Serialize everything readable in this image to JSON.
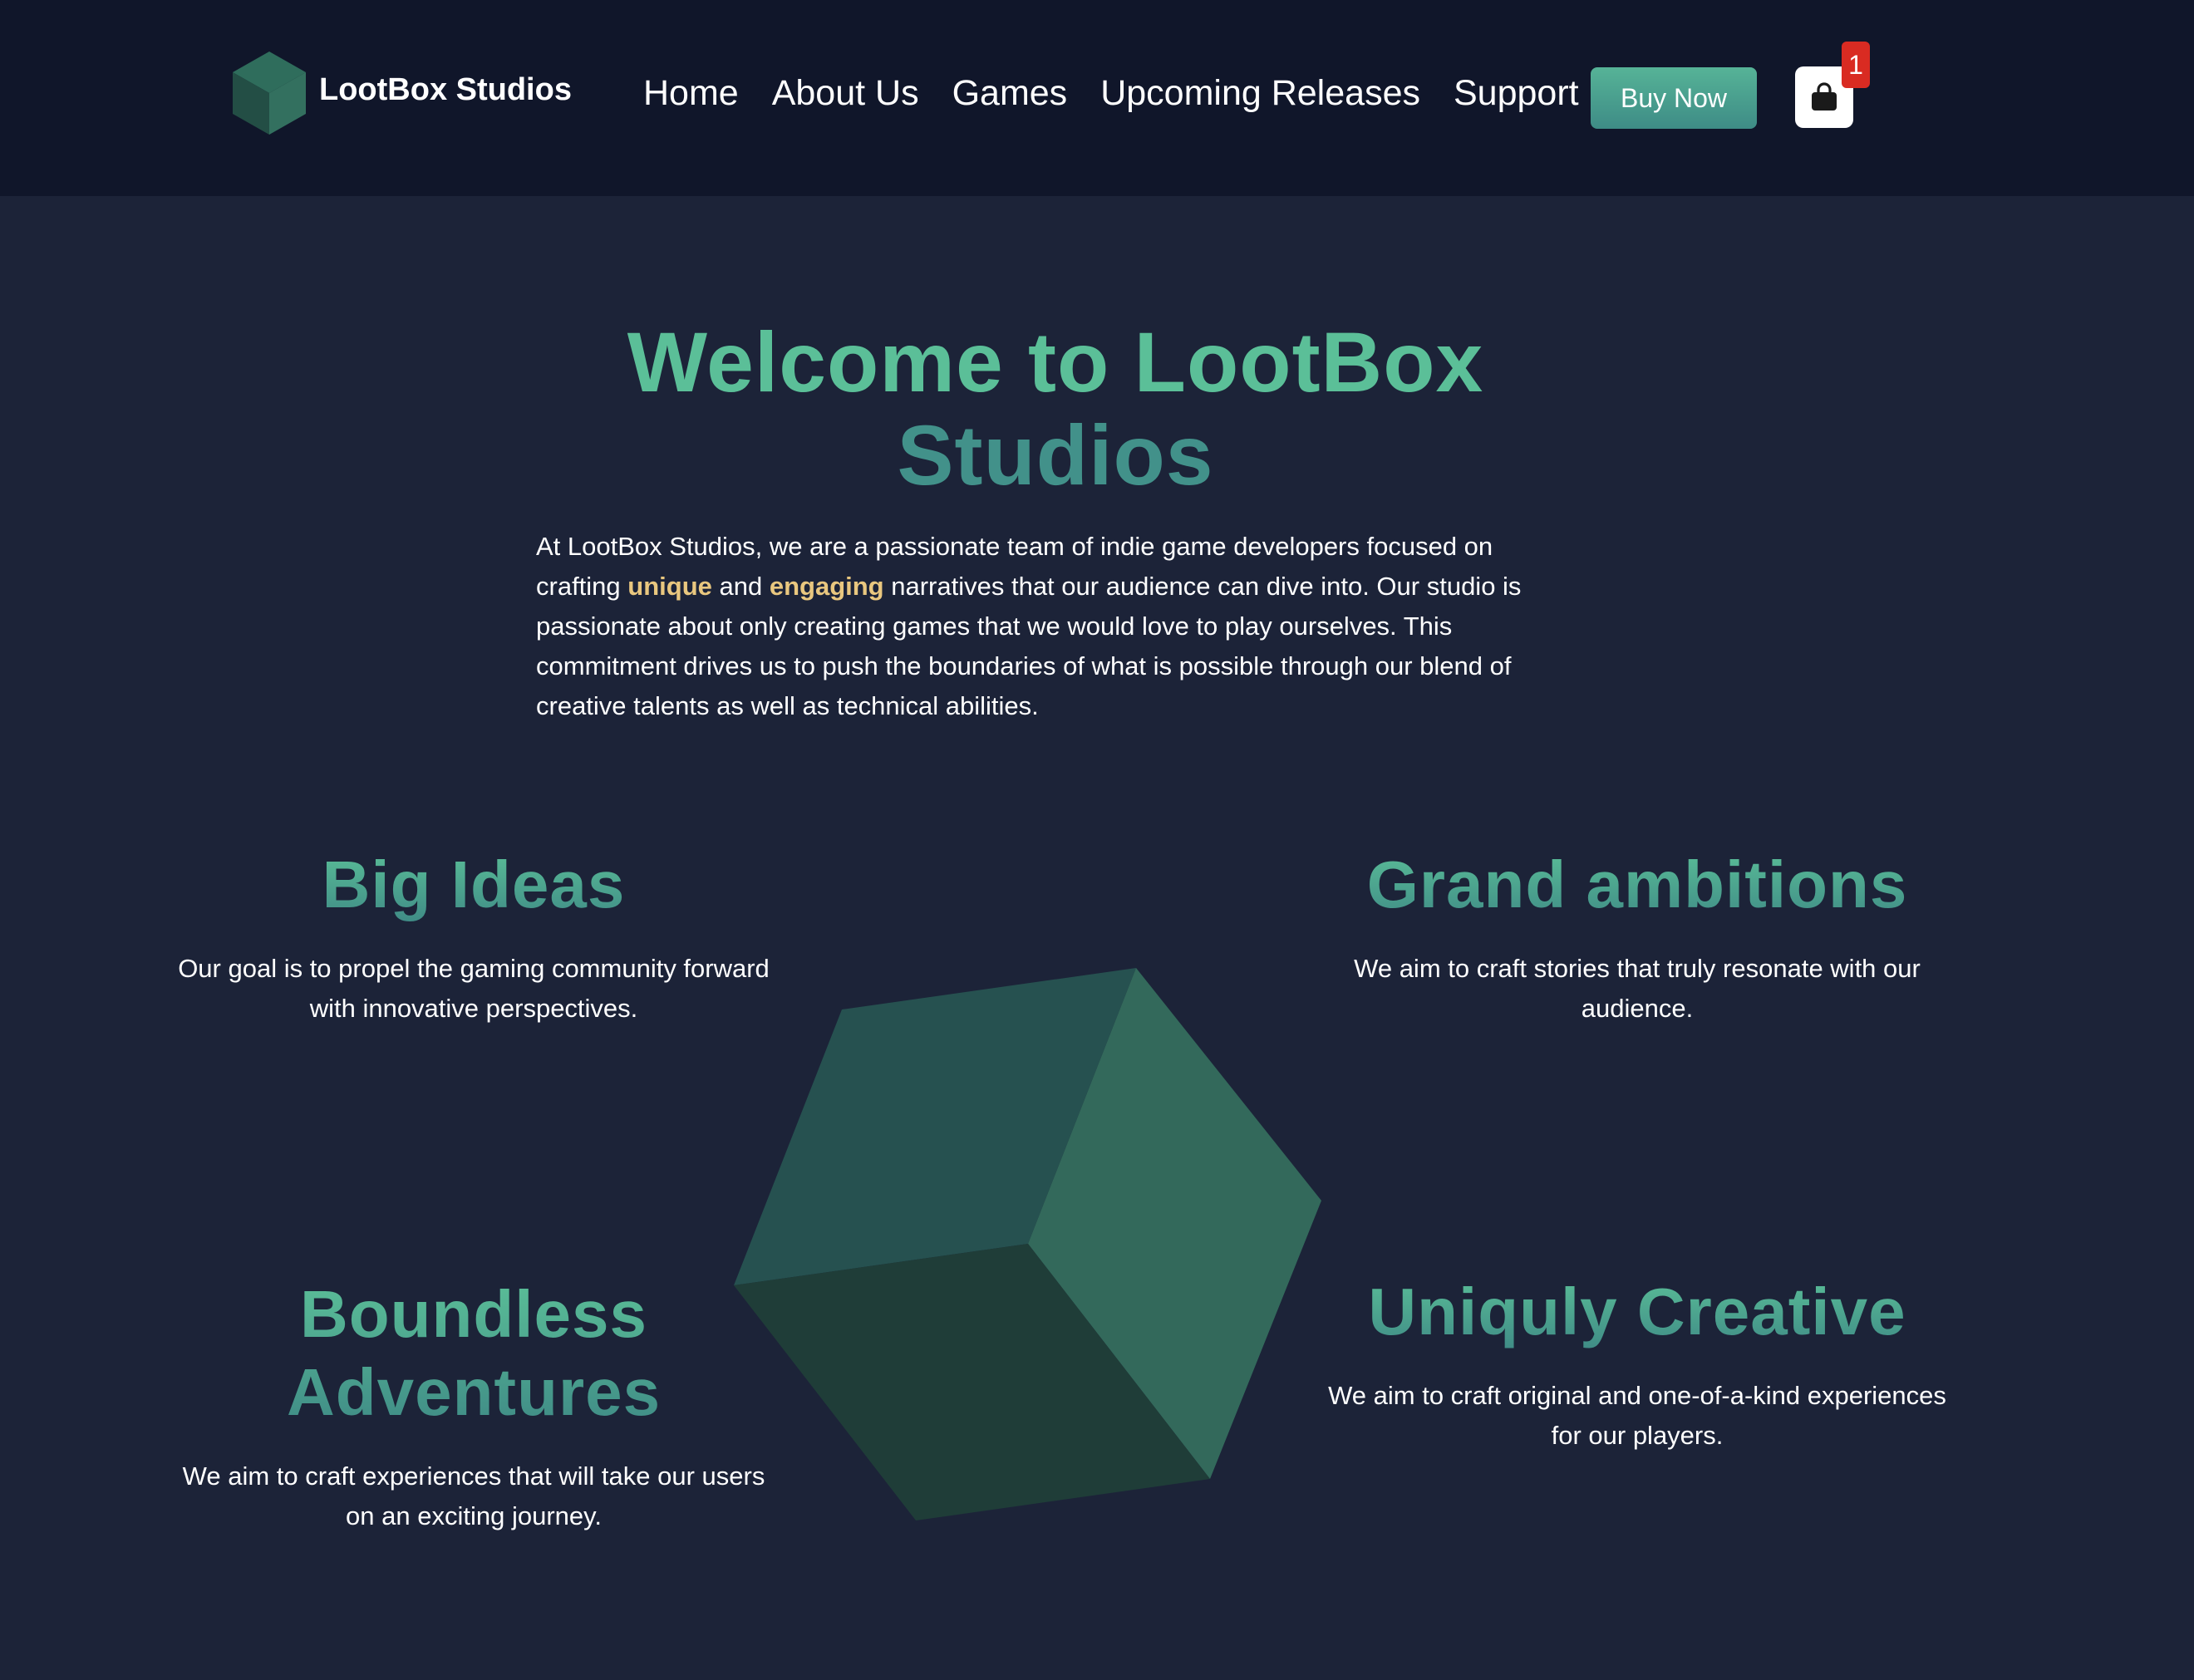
{
  "brand": {
    "name": "LootBox Studios",
    "logo_icon": "cube-logo-icon",
    "colors": {
      "green": "#5bbf98",
      "teal": "#42918a",
      "gold": "#e9c77f",
      "nav_bg": "#10162a",
      "page_bg": "#1c2338",
      "badge_red": "#d92b22"
    }
  },
  "nav": {
    "links": [
      "Home",
      "About Us",
      "Games",
      "Upcoming Releases",
      "Support"
    ],
    "buy_label": "Buy Now",
    "cart_icon": "shopping-bag-icon",
    "cart_count": "1"
  },
  "hero": {
    "title_line1": "Welcome to LootBox",
    "title_line2": "Studios",
    "intro": {
      "part1": "At LootBox Studios, we are a passionate team of indie game developers focused on crafting ",
      "highlight1": "unique",
      "part2": " and ",
      "highlight2": "engaging",
      "part3": " narratives that our audience can dive into. Our studio is passionate about only creating games that we would love to play ourselves. This commitment drives us to push the boundaries of what is possible through our blend of creative talents as well as technical abilities."
    }
  },
  "features": [
    {
      "title_lines": [
        "Big Ideas"
      ],
      "text": "Our goal is to propel the gaming community forward with innovative perspectives."
    },
    {
      "title_lines": [
        "Grand ambitions"
      ],
      "text": "We aim to craft stories that truly resonate with our audience."
    },
    {
      "title_lines": [
        "Boundless",
        "Adventures"
      ],
      "text": "We aim to craft experiences that will take our users on an exciting journey."
    },
    {
      "title_lines": [
        "Uniquly Creative"
      ],
      "text": "We aim to craft original and one-of-a-kind experiences for our players."
    }
  ],
  "decoration": {
    "center_icon": "cube-illustration-icon"
  }
}
